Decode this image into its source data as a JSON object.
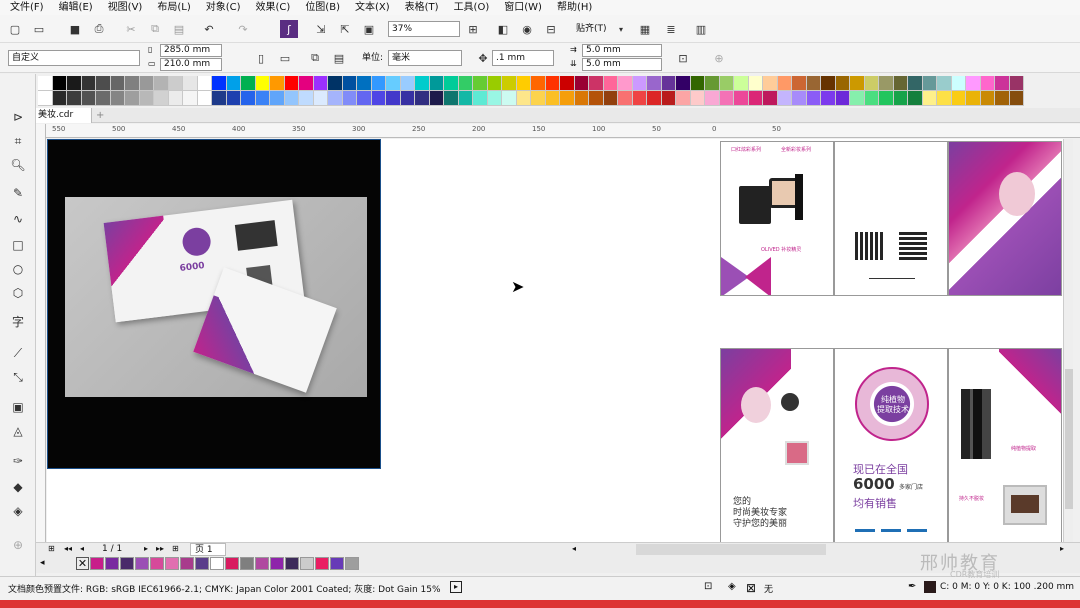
{
  "menu": [
    "文件(F)",
    "编辑(E)",
    "视图(V)",
    "布局(L)",
    "对象(C)",
    "效果(C)",
    "位图(B)",
    "文本(X)",
    "表格(T)",
    "工具(O)",
    "窗口(W)",
    "帮助(H)"
  ],
  "toolbar": {
    "zoom": "37%",
    "snap": "贴齐(T)"
  },
  "props": {
    "preset": "自定义",
    "width": "285.0 mm",
    "height": "210.0 mm",
    "unit_label": "单位:",
    "unit": "毫米",
    "nudge": ".1 mm",
    "dup_x": "5.0 mm",
    "dup_y": "5.0 mm"
  },
  "doc_tab": "美妆.cdr",
  "ruler_labels": [
    "550",
    "500",
    "450",
    "400",
    "350",
    "300",
    "250",
    "200",
    "150",
    "100",
    "50",
    "0",
    "50"
  ],
  "page_nav": {
    "counter": "1 / 1",
    "page_tab": "页 1"
  },
  "status": {
    "profile": "文档颜色预置文件: RGB: sRGB IEC61966-2.1; CMYK: Japan Color 2001 Coated; 灰度: Dot Gain 15%",
    "fill_none": "无",
    "outline": "C: 0 M: 0 Y: 0 K: 100  .200 mm"
  },
  "watermark": {
    "brand": "邢帅教育",
    "sub": "CDR教育培训"
  },
  "brochure": {
    "headline": [
      "您的",
      "时尚美妆专家",
      "守护您的美丽"
    ],
    "stat_line": "现已在全国",
    "stat_number": "6000",
    "stat_unit": "多家门店",
    "stat_tail": "均有销售",
    "circle_text": [
      "纯植物",
      "提取技术"
    ],
    "tags": [
      "口红炫彩系列",
      "全新彩妆系列",
      "OLIVED 补妆精灵",
      "纯植物提取",
      "持久不脱妆"
    ],
    "mock_center": "6000",
    "mock_circle": "纯植物提取技术",
    "mock_text": [
      "现在全国多家门店",
      "均有销售"
    ]
  },
  "colors": {
    "row1": [
      "#ffffff",
      "#000000",
      "#1a1a1a",
      "#333333",
      "#4d4d4d",
      "#666666",
      "#808080",
      "#999999",
      "#b3b3b3",
      "#cccccc",
      "#e6e6e6",
      "#ffffff",
      "#0033ff",
      "#00a0e9",
      "#00b050",
      "#ffff00",
      "#ff9900",
      "#ff0000",
      "#e4007f",
      "#9b30ff",
      "#003366",
      "#0050a0",
      "#0070c0",
      "#3399ff",
      "#66ccff",
      "#99ccff",
      "#00cccc",
      "#009999",
      "#00cc99",
      "#33cc66",
      "#66cc33",
      "#99cc00",
      "#cccc00",
      "#ffcc00",
      "#ff6600",
      "#ff3300",
      "#cc0000",
      "#990033",
      "#cc3366",
      "#ff6699",
      "#ff99cc",
      "#cc99ff",
      "#9966cc",
      "#663399",
      "#330066",
      "#336600",
      "#669933",
      "#99cc66",
      "#ccff99",
      "#ffffcc",
      "#ffcc99",
      "#ff9966",
      "#cc6633",
      "#996633",
      "#663300",
      "#996600",
      "#cc9900",
      "#cccc66",
      "#999966",
      "#666633",
      "#336666",
      "#669999",
      "#99cccc",
      "#ccffff",
      "#ff99ff",
      "#ff66cc",
      "#cc3399",
      "#993366"
    ],
    "row2": [
      "#ffffff",
      "#2b2b2b",
      "#3d3d3d",
      "#525252",
      "#6b6b6b",
      "#858585",
      "#9e9e9e",
      "#b8b8b8",
      "#d1d1d1",
      "#ebebeb",
      "#f5f5f5",
      "#ffffff",
      "#1e3a8a",
      "#1e40af",
      "#2563eb",
      "#3b82f6",
      "#60a5fa",
      "#93c5fd",
      "#bfdbfe",
      "#dbeafe",
      "#a5b4fc",
      "#818cf8",
      "#6366f1",
      "#4f46e5",
      "#4338ca",
      "#3730a3",
      "#312e81",
      "#1e1b4b",
      "#0f766e",
      "#14b8a6",
      "#5eead4",
      "#99f6e4",
      "#ccfbf1",
      "#fde68a",
      "#fcd34d",
      "#fbbf24",
      "#f59e0b",
      "#d97706",
      "#b45309",
      "#92400e",
      "#f87171",
      "#ef4444",
      "#dc2626",
      "#b91c1c",
      "#fca5a5",
      "#fecaca",
      "#f9a8d4",
      "#f472b6",
      "#ec4899",
      "#db2777",
      "#be185d",
      "#c4b5fd",
      "#a78bfa",
      "#8b5cf6",
      "#7c3aed",
      "#6d28d9",
      "#86efac",
      "#4ade80",
      "#22c55e",
      "#16a34a",
      "#15803d",
      "#fef08a",
      "#fde047",
      "#facc15",
      "#eab308",
      "#ca8a04",
      "#a16207",
      "#854d0e"
    ],
    "doc": [
      "#c81e8a",
      "#7a2aa0",
      "#4a2a6a",
      "#9b4fb5",
      "#d64a9a",
      "#e06fb0",
      "#a83c8c",
      "#5a3d8a",
      "#ffffff",
      "#d81b60",
      "#7f7f7f",
      "#b04aa0",
      "#8e24aa",
      "#3d2b5a",
      "#cccccc",
      "#e91e63",
      "#673ab7",
      "#9e9e9e"
    ],
    "accent": "#c0248c",
    "purple": "#7b3fa0"
  }
}
